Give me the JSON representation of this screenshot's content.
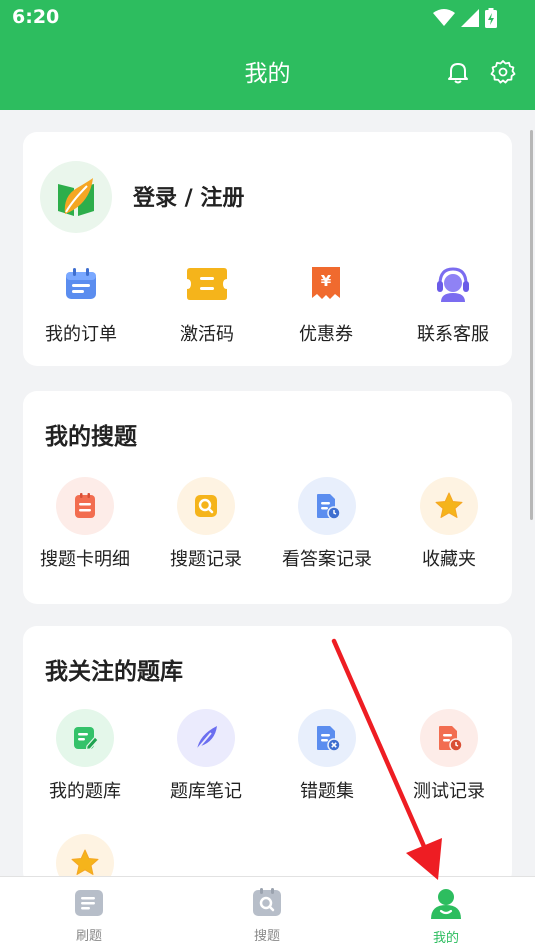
{
  "status": {
    "time": "6:20"
  },
  "header": {
    "title": "我的",
    "bell_icon": "bell-icon",
    "settings_icon": "gear-icon"
  },
  "profile": {
    "login_label": "登录 / 注册",
    "actions": [
      {
        "label": "我的订单",
        "icon": "calendar-order-icon",
        "color": "#5b8def"
      },
      {
        "label": "激活码",
        "icon": "ticket-code-icon",
        "color": "#f5a623"
      },
      {
        "label": "优惠券",
        "icon": "yen-coupon-icon",
        "color": "#f06a2e"
      },
      {
        "label": "联系客服",
        "icon": "headset-icon",
        "color": "#7b6cf0"
      }
    ]
  },
  "search_section": {
    "title": "我的搜题",
    "items": [
      {
        "label": "搜题卡明细",
        "icon": "card-detail-icon",
        "color": "#f26d50",
        "bg": "#fdece8"
      },
      {
        "label": "搜题记录",
        "icon": "search-record-icon",
        "color": "#f5a623",
        "bg": "#fef3e2"
      },
      {
        "label": "看答案记录",
        "icon": "answer-record-icon",
        "color": "#5b8def",
        "bg": "#e8effc"
      },
      {
        "label": "收藏夹",
        "icon": "star-icon",
        "color": "#f5a623",
        "bg": "#fef3e2"
      }
    ]
  },
  "follow_section": {
    "title": "我关注的题库",
    "items": [
      {
        "label": "我的题库",
        "icon": "edit-bank-icon",
        "color": "#34c26a",
        "bg": "#e4f7ea"
      },
      {
        "label": "题库笔记",
        "icon": "feather-icon",
        "color": "#6b6ef0",
        "bg": "#ebebfd"
      },
      {
        "label": "错题集",
        "icon": "wrong-set-icon",
        "color": "#5b8def",
        "bg": "#e8effc"
      },
      {
        "label": "测试记录",
        "icon": "test-record-icon",
        "color": "#f26d50",
        "bg": "#fdece8"
      },
      {
        "label": "",
        "icon": "star-icon",
        "color": "#f5a623",
        "bg": "#fef3e2"
      }
    ]
  },
  "bottom_nav": [
    {
      "label": "刷题",
      "icon": "practice-icon",
      "active": false
    },
    {
      "label": "搜题",
      "icon": "search-tab-icon",
      "active": false
    },
    {
      "label": "我的",
      "icon": "profile-icon",
      "active": true
    }
  ],
  "colors": {
    "brand": "#2dbd5f",
    "arrow": "#ee1d23"
  }
}
